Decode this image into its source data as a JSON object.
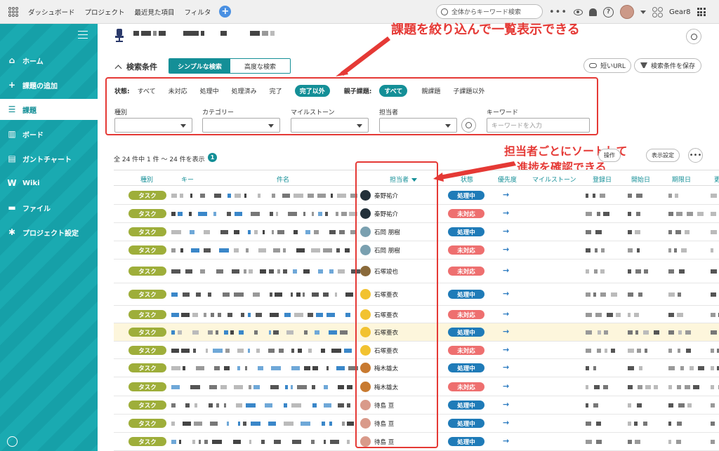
{
  "topbar": {
    "nav": [
      "ダッシュボード",
      "プロジェクト",
      "最近見た項目",
      "フィルタ"
    ],
    "search_placeholder": "全体からキーワード検索",
    "space_name": "Gear8"
  },
  "sidebar": {
    "items": [
      {
        "label": "ホーム",
        "icon": "home-icon",
        "glyph": "⌂"
      },
      {
        "label": "課題の追加",
        "icon": "plus-icon",
        "glyph": "+"
      },
      {
        "label": "課題",
        "icon": "list-icon",
        "glyph": "☰"
      },
      {
        "label": "ボード",
        "icon": "board-icon",
        "glyph": "▥"
      },
      {
        "label": "ガントチャート",
        "icon": "gantt-icon",
        "glyph": "▤"
      },
      {
        "label": "Wiki",
        "icon": "wiki-icon",
        "glyph": "W"
      },
      {
        "label": "ファイル",
        "icon": "folder-icon",
        "glyph": "▬"
      },
      {
        "label": "プロジェクト設定",
        "icon": "gear-icon",
        "glyph": "✱"
      }
    ],
    "active_index": 2
  },
  "conditions": {
    "title": "検索条件",
    "tab_simple": "シンプルな検索",
    "tab_advanced": "高度な検索",
    "short_url": "短いURL",
    "save_conditions": "検索条件を保存",
    "status_label": "状態:",
    "status_options": [
      "すべて",
      "未対応",
      "処理中",
      "処理済み",
      "完了",
      "完了以外"
    ],
    "status_selected": 5,
    "parent_label": "親子課題:",
    "parent_options": [
      "すべて",
      "親課題",
      "子課題以外"
    ],
    "parent_selected": 0,
    "fields": [
      "種別",
      "カテゴリー",
      "マイルストーン",
      "担当者",
      "キーワード"
    ],
    "keyword_placeholder": "キーワードを入力"
  },
  "callouts": {
    "top": "課題を絞り込んで一覧表示できる",
    "assignee_line1": "担当者ごとにソートして",
    "assignee_line2": "進捗を確認できる"
  },
  "results": {
    "count_text": "全 24 件中 1 件 〜 24 件を表示",
    "badge": "1",
    "bulk_label": "操作",
    "display_label": "表示設定"
  },
  "table": {
    "headers": [
      "種別",
      "キー",
      "件名",
      "担当者",
      "状態",
      "優先度",
      "マイルストーン",
      "登録日",
      "開始日",
      "期限日",
      "更"
    ],
    "sorted_column": 3,
    "rows": [
      {
        "type": "タスク",
        "assignee": "秦野祐介",
        "status": "処理中",
        "avatar_color": "#22303a"
      },
      {
        "type": "タスク",
        "assignee": "秦野祐介",
        "status": "未対応",
        "avatar_color": "#22303a"
      },
      {
        "type": "タスク",
        "assignee": "石岡 朋樹",
        "status": "処理中",
        "avatar_color": "#7aa0b0"
      },
      {
        "type": "タスク",
        "assignee": "石岡 朋樹",
        "status": "未対応",
        "avatar_color": "#7aa0b0"
      },
      {
        "type": "タスク",
        "assignee": "石塚竣也",
        "status": "未対応",
        "avatar_color": "#8a6a3a"
      },
      {
        "type": "タスク",
        "assignee": "石塚亜衣",
        "status": "処理中",
        "avatar_color": "#f2c230"
      },
      {
        "type": "タスク",
        "assignee": "石塚亜衣",
        "status": "未対応",
        "avatar_color": "#f2c230"
      },
      {
        "type": "タスク",
        "assignee": "石塚亜衣",
        "status": "処理中",
        "avatar_color": "#f2c230"
      },
      {
        "type": "タスク",
        "assignee": "石塚亜衣",
        "status": "未対応",
        "avatar_color": "#f2c230"
      },
      {
        "type": "タスク",
        "assignee": "梅木雄太",
        "status": "処理中",
        "avatar_color": "#c87a30"
      },
      {
        "type": "タスク",
        "assignee": "梅木雄太",
        "status": "未対応",
        "avatar_color": "#c87a30"
      },
      {
        "type": "タスク",
        "assignee": "待島 亘",
        "status": "処理中",
        "avatar_color": "#d99a8a"
      },
      {
        "type": "タスク",
        "assignee": "待島 亘",
        "status": "処理中",
        "avatar_color": "#d99a8a"
      },
      {
        "type": "タスク",
        "assignee": "待島 亘",
        "status": "処理中",
        "avatar_color": "#d99a8a"
      }
    ],
    "priority_glyph": "→"
  },
  "colors": {
    "accent": "#148f97",
    "status_in_progress": "#1f7bb8",
    "status_open": "#ee6f6f",
    "type_task": "#9eae3a",
    "callout": "#e53935",
    "highlight_row": "#fdf6dc"
  }
}
